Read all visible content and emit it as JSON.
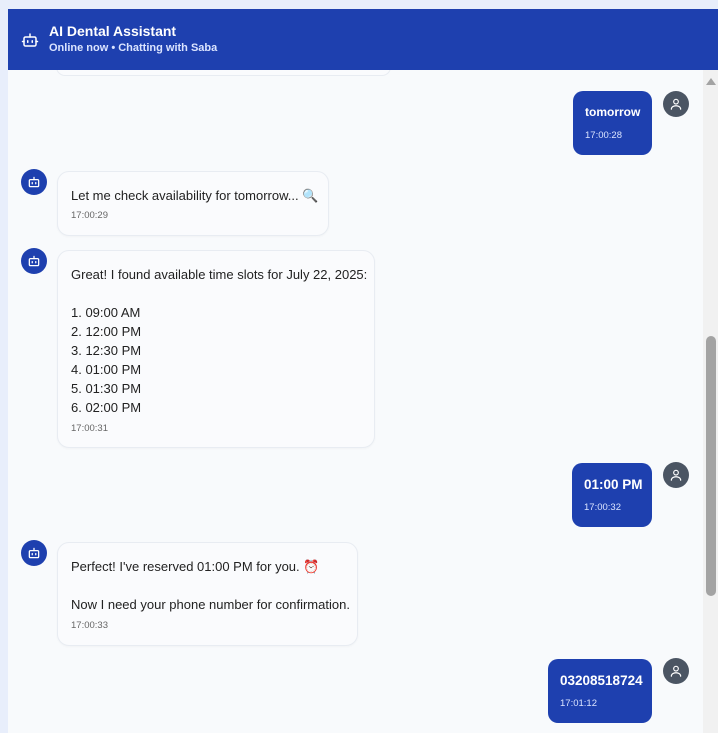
{
  "header": {
    "title": "AI Dental Assistant",
    "subtitle": "Online now • Chatting with Saba",
    "icon": "bot-icon"
  },
  "messages": [
    {
      "sender": "user",
      "text": "tomorrow",
      "time": "17:00:28"
    },
    {
      "sender": "bot",
      "text": "Let me check availability for tomorrow... 🔍",
      "time": "17:00:29"
    },
    {
      "sender": "bot",
      "text": "Great! I found available time slots for July 22, 2025:\n\n1. 09:00 AM\n2. 12:00 PM\n3. 12:30 PM\n4. 01:00 PM\n5. 01:30 PM\n6. 02:00 PM",
      "time": "17:00:31"
    },
    {
      "sender": "user",
      "text": "01:00 PM",
      "time": "17:00:32"
    },
    {
      "sender": "bot",
      "text": "Perfect! I've reserved 01:00 PM for you. ⏰\n\nNow I need your phone number for confirmation.",
      "time": "17:00:33"
    },
    {
      "sender": "user",
      "text": "03208518724",
      "time": "17:01:12"
    }
  ],
  "colors": {
    "primary": "#1e40af",
    "user_avatar": "#4b5563",
    "chat_background": "#f8fafc"
  }
}
